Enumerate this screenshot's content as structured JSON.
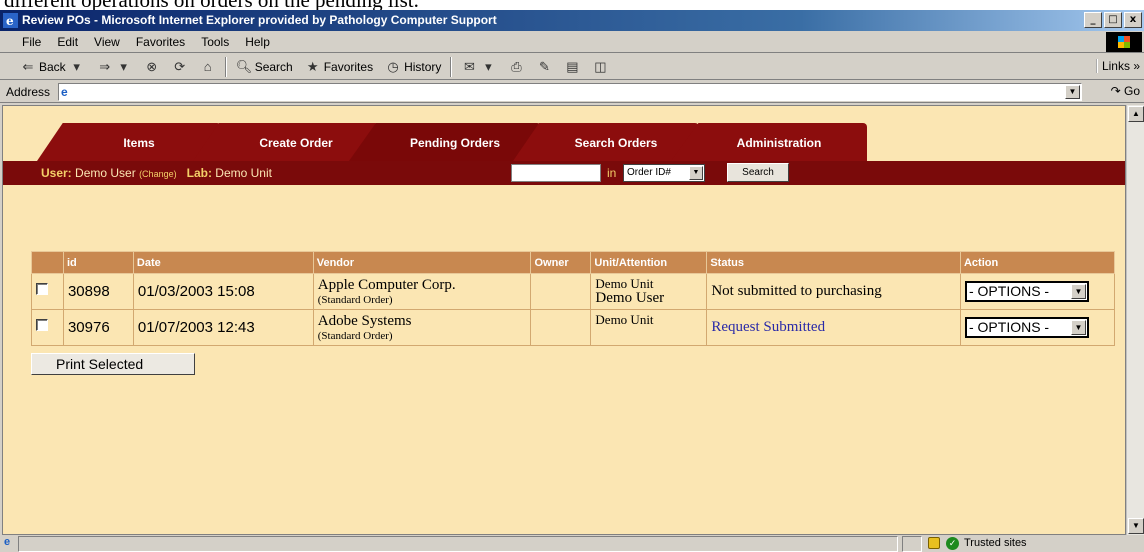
{
  "caption": "different operations on orders on the pending list.",
  "window": {
    "title": "Review POs - Microsoft Internet Explorer provided by Pathology Computer Support",
    "controls": [
      "_",
      "□",
      "x"
    ]
  },
  "menu": {
    "items": [
      "File",
      "Edit",
      "View",
      "Favorites",
      "Tools",
      "Help"
    ]
  },
  "toolbar": {
    "back": "Back",
    "search": "Search",
    "favorites": "Favorites",
    "history": "History",
    "links": "Links »"
  },
  "address": {
    "label": "Address",
    "value": "",
    "go": "Go"
  },
  "tabs": [
    "Items",
    "Create Order",
    "Pending Orders",
    "Search Orders",
    "Administration"
  ],
  "active_tab": "Pending Orders",
  "userbar": {
    "user_label": "User:",
    "user_value": "Demo User",
    "change": "(Change)",
    "lab_label": "Lab:",
    "lab_value": "Demo Unit",
    "in_label": "in",
    "search_field_value": "",
    "order_select_value": "Order ID#",
    "search_button": "Search"
  },
  "table": {
    "headers": [
      "",
      "id",
      "Date",
      "Vendor",
      "Owner",
      "Unit/Attention",
      "Status",
      "Action"
    ],
    "rows": [
      {
        "id": "30898",
        "date": "01/03/2003 15:08",
        "vendor": "Apple Computer Corp.",
        "order_type": "(Standard Order)",
        "owner": "",
        "unit": "Demo Unit",
        "attention": "Demo User",
        "status": "Not submitted to purchasing",
        "action": "- OPTIONS -"
      },
      {
        "id": "30976",
        "date": "01/07/2003 12:43",
        "vendor": "Adobe Systems",
        "order_type": "(Standard Order)",
        "owner": "",
        "unit": "Demo Unit",
        "attention": "",
        "status": "Request Submitted",
        "action": "- OPTIONS -"
      }
    ]
  },
  "print_button": "Print Selected",
  "statusbar": {
    "zone": "Trusted sites"
  },
  "colors": {
    "tab_red": "#8c0d0d",
    "page_bg": "#fbe6b3",
    "header_tan": "#c88850",
    "link_blue": "#2a2aa8"
  }
}
